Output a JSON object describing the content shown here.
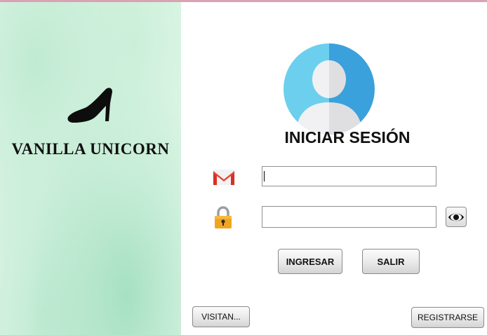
{
  "brand": {
    "name": "VANILLA UNICORN",
    "logo_icon": "high-heel-shoe-icon"
  },
  "login": {
    "title": "INICIAR SESIÓN",
    "avatar_icon": "user-avatar-icon",
    "email": {
      "icon": "gmail-icon",
      "value": "",
      "placeholder": ""
    },
    "password": {
      "icon": "lock-icon",
      "value": "",
      "placeholder": "",
      "toggle_icon": "eye-icon"
    }
  },
  "buttons": {
    "ingresar": "INGRESAR",
    "salir": "SALIR",
    "visitante": "VISITAN...",
    "registrarse": "REGISTRARSE"
  },
  "colors": {
    "top_bar": "#d9a3b3",
    "panel_green": "#e4f8ea",
    "avatar_blue": "#4ab3e6"
  }
}
